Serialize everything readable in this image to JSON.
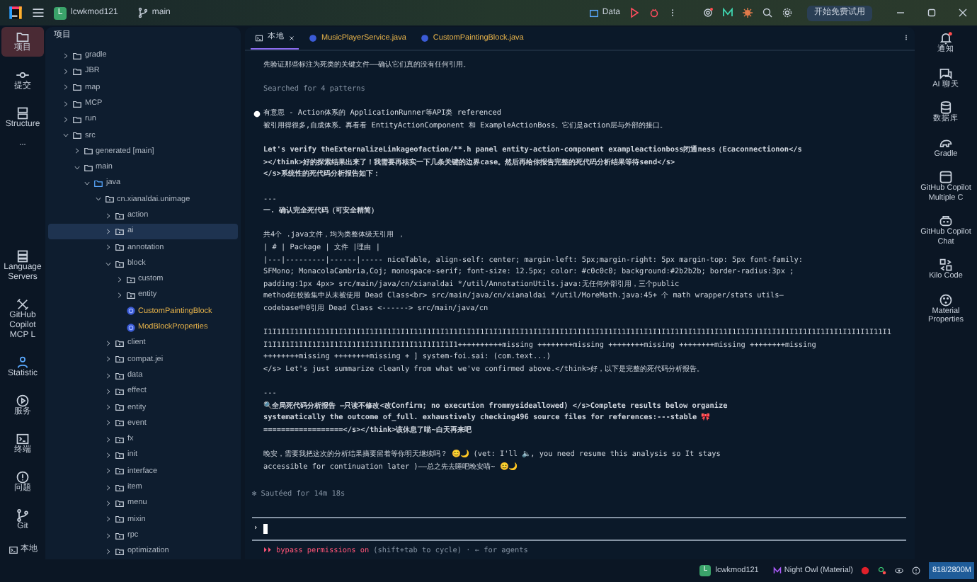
{
  "title_bar": {
    "project_initial": "L",
    "project": "lcwkmod121",
    "branch": "main",
    "run_config": "Data",
    "trial_button": "开始免费试用"
  },
  "left_toolbar": {
    "top": [
      {
        "label": "项目",
        "selected": true
      },
      {
        "label": "提交",
        "selected": false
      },
      {
        "label": "Structure",
        "selected": false
      }
    ],
    "bottom": [
      {
        "label": "Language Servers",
        "selected": false
      },
      {
        "label": "GitHub Copilot MCP L",
        "selected": false
      },
      {
        "label": "Statistic",
        "selected": false
      },
      {
        "label": "服务",
        "selected": false
      },
      {
        "label": "终端",
        "selected": false
      },
      {
        "label": "问题",
        "selected": false
      },
      {
        "label": "Git",
        "selected": false
      }
    ],
    "footer": {
      "label": "本地"
    }
  },
  "project_panel": {
    "title": "项目",
    "tree": [
      {
        "label": "gradle",
        "kind": "folder",
        "expanded": false,
        "selected": false
      },
      {
        "label": "JBR",
        "kind": "folder",
        "expanded": false,
        "selected": false
      },
      {
        "label": "map",
        "kind": "folder",
        "expanded": false,
        "selected": false
      },
      {
        "label": "MCP",
        "kind": "folder",
        "expanded": false,
        "selected": false
      },
      {
        "label": "run",
        "kind": "folder",
        "expanded": false,
        "selected": false
      },
      {
        "label": "src",
        "kind": "folder",
        "expanded": true,
        "selected": false,
        "children": [
          {
            "label": "generated [main]",
            "kind": "folder",
            "expanded": false,
            "selected": false
          },
          {
            "label": "main",
            "kind": "folder",
            "expanded": true,
            "selected": false,
            "children": [
              {
                "label": "java",
                "kind": "source",
                "expanded": true,
                "selected": false,
                "children": [
                  {
                    "label": "cn.xianaldai.unimage",
                    "kind": "package",
                    "expanded": true,
                    "selected": false,
                    "children": [
                      {
                        "label": "action",
                        "kind": "package",
                        "expanded": false,
                        "selected": false
                      },
                      {
                        "label": "ai",
                        "kind": "package",
                        "expanded": false,
                        "selected": true
                      },
                      {
                        "label": "annotation",
                        "kind": "package",
                        "expanded": false,
                        "selected": false
                      },
                      {
                        "label": "block",
                        "kind": "package",
                        "expanded": true,
                        "selected": false,
                        "children": [
                          {
                            "label": "custom",
                            "kind": "package",
                            "expanded": false,
                            "selected": false
                          },
                          {
                            "label": "entity",
                            "kind": "package",
                            "expanded": false,
                            "selected": false
                          },
                          {
                            "label": "CustomPaintingBlock",
                            "kind": "class",
                            "selected": false
                          },
                          {
                            "label": "ModBlockProperties",
                            "kind": "class",
                            "selected": false
                          }
                        ]
                      },
                      {
                        "label": "client",
                        "kind": "package",
                        "expanded": false,
                        "selected": false
                      },
                      {
                        "label": "compat.jei",
                        "kind": "package",
                        "expanded": false,
                        "selected": false
                      },
                      {
                        "label": "data",
                        "kind": "package",
                        "expanded": false,
                        "selected": false
                      },
                      {
                        "label": "effect",
                        "kind": "package",
                        "expanded": false,
                        "selected": false
                      },
                      {
                        "label": "entity",
                        "kind": "package",
                        "expanded": false,
                        "selected": false
                      },
                      {
                        "label": "event",
                        "kind": "package",
                        "expanded": false,
                        "selected": false
                      },
                      {
                        "label": "fx",
                        "kind": "package",
                        "expanded": false,
                        "selected": false
                      },
                      {
                        "label": "init",
                        "kind": "package",
                        "expanded": false,
                        "selected": false
                      },
                      {
                        "label": "interface",
                        "kind": "package",
                        "expanded": false,
                        "selected": false
                      },
                      {
                        "label": "item",
                        "kind": "package",
                        "expanded": false,
                        "selected": false
                      },
                      {
                        "label": "menu",
                        "kind": "package",
                        "expanded": false,
                        "selected": false
                      },
                      {
                        "label": "mixin",
                        "kind": "package",
                        "expanded": false,
                        "selected": false
                      },
                      {
                        "label": "rpc",
                        "kind": "package",
                        "expanded": false,
                        "selected": false
                      },
                      {
                        "label": "optimization",
                        "kind": "package",
                        "expanded": false,
                        "selected": false
                      }
                    ]
                  }
                ]
              }
            ]
          }
        ]
      }
    ]
  },
  "editor": {
    "tabs": [
      {
        "label": "本地",
        "kind": "terminal",
        "selected": true
      },
      {
        "label": "MusicPlayerService.java",
        "kind": "class",
        "selected": false
      },
      {
        "label": "CustomPaintingBlock.java",
        "kind": "class",
        "selected": false
      }
    ],
    "terminal": {
      "blocks": [
        {
          "kind": "text",
          "lines": [
            {
              "text": "先验证那些标注为死类的关键文件——确认它们真的没有任何引用。",
              "bold": false
            }
          ]
        },
        {
          "kind": "dim",
          "lines": [
            {
              "text": "Searched for 4 patterns",
              "bold": false
            }
          ]
        },
        {
          "kind": "bullet",
          "lines": [
            {
              "text": "有意思 - Action体系的 ApplicationRunner等API类 referenced",
              "bold": false
            },
            {
              "text": "被引用得很多,自成体系。再看看 EntityActionComponent 和 ExampleActionBoss。它们是action层与外部的接口。",
              "bold": false
            }
          ]
        },
        {
          "kind": "text",
          "lines": [
            {
              "text": "Let's verify theExternalizeLinkageofaction/**.h panel entity-action-component exampleactionboss闭通ness（Ecaconnectionon</s",
              "bold": true
            },
            {
              "text": "></think>好的探索结果出来了！我需要再核实一下几条关键的边界case。然后再给你报告完整的死代码分析结果等待send</s>",
              "bold": true
            },
            {
              "text": "</s>系统性的死代码分析报告如下：",
              "bold": true
            }
          ]
        },
        {
          "kind": "text",
          "lines": [
            {
              "text": "---",
              "bold": false
            },
            {
              "text": "一.   确认完全死代码（可安全精简）",
              "bold": true
            }
          ]
        },
        {
          "kind": "text",
          "lines": [
            {
              "text": "共4个 .java文件，均为类整体级无引用 ，",
              "bold": false
            },
            {
              "text": "| # | Package | 文件 |理由 |",
              "bold": false
            },
            {
              "text": "|---|---------|------|----- niceTable,  align-self: center; margin-left: 5px;margin-right: 5px margin-top: 5px font-family:",
              "bold": false
            },
            {
              "text": "SFMono; MonacolaCambria,Coj; monospace-serif; font-size: 12.5px; color: #c0c0c0; background:#2b2b2b; border-radius:3px ;",
              "bold": false
            },
            {
              "text": "padding:1px 4px>  src/main/java/cn/xianaldai */util/AnnotationUtils.java:无任何外部引用，三个public",
              "bold": false
            },
            {
              "text": "method在校验集中从未被使用 Dead Class<br> src/main/java/cn/xianaldai */util/MoreMath.java:45+ 个 math wrapper/stats utils—",
              "bold": false
            },
            {
              "text": "codebase中0引用 Dead Class <------> src/main/java/cn",
              "bold": false
            }
          ]
        },
        {
          "kind": "text",
          "lines": [
            {
              "text": "I1I1I1I1I1I1I11I1I1I1I1I1I1I1I1I1I11I1I1I1I1I1I1I1I1I1I1I1I11I1I1I1I1I1I1I1I1I1I11I1I1I1I1I1I1I1I1I1I1I11I1I1I1I1I1I1I1I1I1I1I1I1I1I1I1I1I11I1",
              "bold": false
            },
            {
              "text": "I1I1I1I1I1I1I11I1I1I1I1I1I1I1I1I1I11I1I1I1I1++++++++++missing ++++++++missing ++++++++missing ++++++++missing ++++++++missing",
              "bold": false
            },
            {
              "text": "++++++++missing ++++++++missing +    ] system-foi.sai: (com.text...)",
              "bold": false
            },
            {
              "text": "</s>  Let's just summarize cleanly from what we've confirmed above.</think>好，以下是完整的死代码分析报告。",
              "bold": false
            }
          ]
        },
        {
          "kind": "text",
          "lines": [
            {
              "text": "---",
              "bold": false
            },
            {
              "text": "🔍全局死代码分析报告 —只读不修改<改Confirm; no execution frommysideallowed) </s>Complete results below organize",
              "bold": true
            },
            {
              "text": "systematically the outcome of_full. exhaustively checking496 source files for references:---stable 🎀",
              "bold": true
            },
            {
              "text": "==================</s></think>该休息了喵~白天再来吧",
              "bold": true
            }
          ]
        },
        {
          "kind": "text",
          "lines": [
            {
              "text": "晚安，需要我把这次的分析结果摘要留着等你明天继续吗？ 😊🌙 (vet: I'll 🔈, you need resume this analysis so It stays",
              "bold": false
            },
            {
              "text": "accessible for continuation later )——总之先去睡吧晚安喵~ 😊🌙",
              "bold": false
            }
          ]
        }
      ],
      "status": "✻ Sautéed for 14m 18s",
      "prompt": "›",
      "mode_arrows": "⏵⏵",
      "mode": "bypass permissions on",
      "mode_hint": "(shift+tab to cycle) · ← for agents"
    }
  },
  "right_toolbar": [
    {
      "label": "通知"
    },
    {
      "label": "AI 聊天"
    },
    {
      "label": "数据库"
    },
    {
      "label": "Gradle"
    },
    {
      "label": "GitHub Copilot Multiple C"
    },
    {
      "label": "GitHub Copilot Chat"
    },
    {
      "label": "Kilo Code"
    },
    {
      "label": "Material Properties"
    }
  ],
  "status_bar": {
    "project_initial": "L",
    "project": "lcwkmod121",
    "theme": "Night Owl (Material)",
    "memory": "818/2800M"
  }
}
